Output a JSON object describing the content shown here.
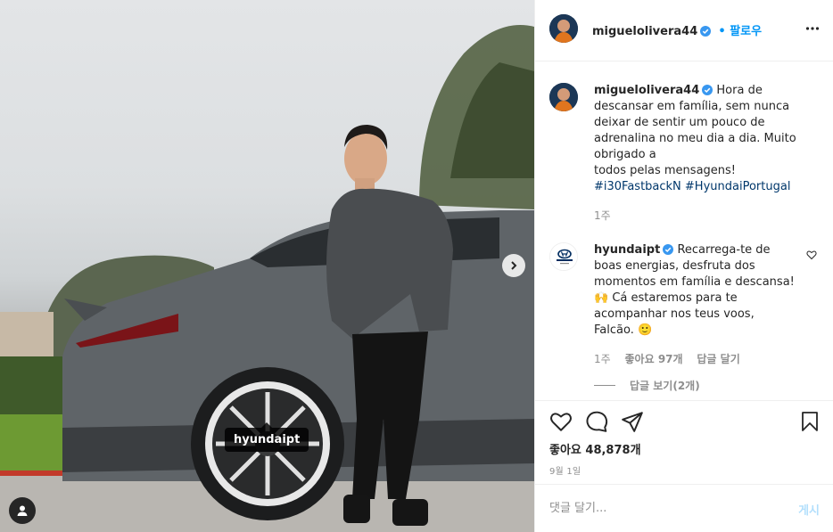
{
  "post": {
    "author": "miguelolivera44",
    "follow_label": "• 팔로우",
    "caption_lines": [
      "Hora de",
      "descansar em família, sem nunca",
      "deixar de sentir um pouco de",
      "adrenalina no meu dia a dia. Muito",
      "obrigado a",
      "todos pelas mensagens!"
    ],
    "hashtags": "#i30FastbackN #HyundaiPortugal",
    "caption_age": "1주",
    "image_tag": "hyundaipt"
  },
  "comment": {
    "author": "hyundaipt",
    "avatar_brand": "HYUNDAI",
    "avatar_sub": "Portugal",
    "lines": [
      "Recarrega-te de",
      "boas energias, desfruta dos",
      "momentos em família e descansa!",
      "🙌 Cá estaremos para te",
      "acompanhar nos teus voos,",
      "Falcão. 🙂"
    ],
    "age": "1주",
    "likes": "좋아요 97개",
    "reply_label": "답글 달기",
    "view_replies": "답글 보기(2개)"
  },
  "stats": {
    "likes": "좋아요 48,878개",
    "date": "9월 1일"
  },
  "composer": {
    "placeholder": "댓글 달기...",
    "post_label": "게시"
  },
  "colors": {
    "accent": "#0095f6",
    "verified": "#3897f0",
    "hashtag": "#00376b",
    "muted": "#8e8e8e"
  },
  "icons": [
    "verified-badge-icon",
    "more-options-icon",
    "heart-icon",
    "comment-icon",
    "share-icon",
    "bookmark-icon",
    "chevron-right-icon",
    "user-tag-icon"
  ]
}
